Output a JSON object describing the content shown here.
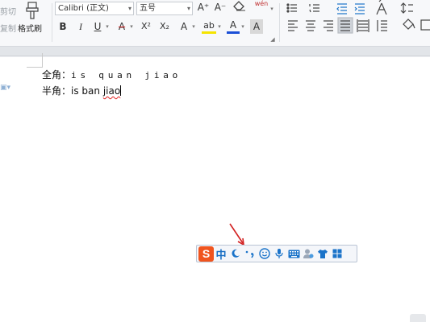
{
  "ribbon": {
    "cut_label": "剪切",
    "copy_label": "复制",
    "format_painter_label": "格式刷",
    "font_name": "Calibri (正文)",
    "font_size": "五号",
    "bold": "B",
    "italic": "I",
    "underline": "U",
    "strikethrough": "A",
    "superscript": "X²",
    "subscript": "X₂",
    "font_color_a": "A",
    "highlight": "ab",
    "font_color": "A",
    "char_shading": "A",
    "grow_font": "A⁺",
    "shrink_font": "A⁻",
    "phonetic": "wén",
    "text_effects": "A"
  },
  "document": {
    "line1_label": "全角：",
    "line1_text": "is quan jiao",
    "line2_label": "半角：",
    "line2_text_a": "is ban ",
    "line2_text_b": "jiao"
  },
  "ime": {
    "logo": "S",
    "mode": "中",
    "icons": [
      "moon-icon",
      "punctuation-icon",
      "emoji-icon",
      "microphone-icon",
      "keyboard-icon",
      "user-icon",
      "skin-shirt-icon",
      "toolbox-grid-icon"
    ]
  },
  "colors": {
    "ime_logo": "#f0541e",
    "ime_icon": "#1a73c9",
    "font_color_bar": "#1a4fd6",
    "highlight_bar": "#f5e400",
    "strike_color": "#d21e1e",
    "annotation_arrow": "#d22020"
  }
}
